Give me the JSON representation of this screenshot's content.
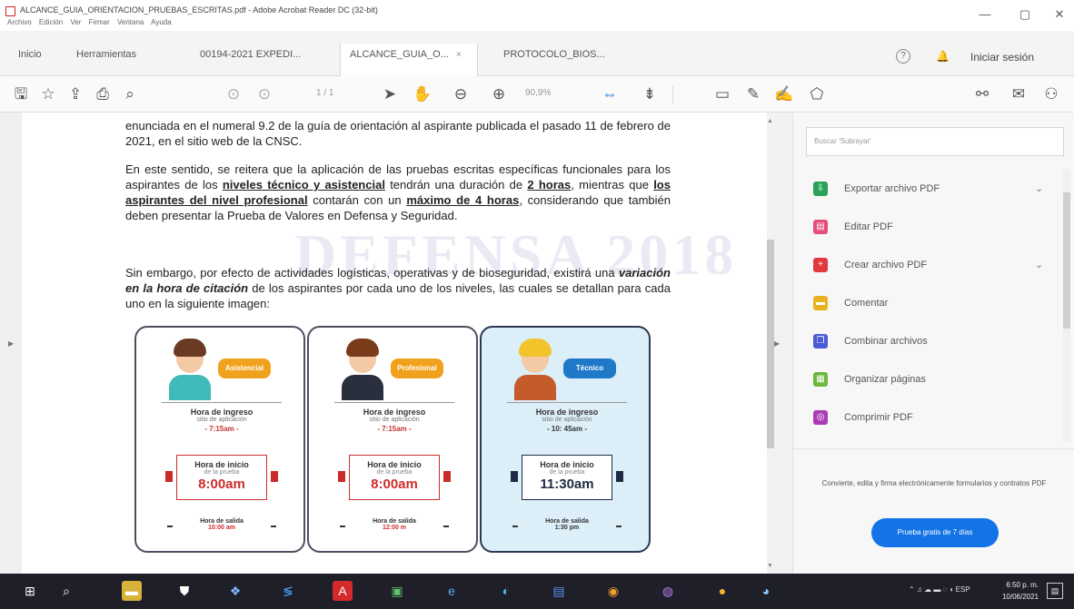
{
  "window": {
    "title": "ALCANCE_GUIA_ORIENTACION_PRUEBAS_ESCRITAS.pdf - Adobe Acrobat Reader DC (32-bit)",
    "menu": [
      "Archivo",
      "Edición",
      "Ver",
      "Firmar",
      "Ventana",
      "Ayuda"
    ],
    "controls": {
      "minimize": "—",
      "maximize": "▢",
      "close": "✕"
    }
  },
  "tabs": {
    "items": [
      {
        "label": "Inicio",
        "active": false
      },
      {
        "label": "Herramientas",
        "active": false
      },
      {
        "label": "00194-2021 EXPEDI...",
        "active": false
      },
      {
        "label": "ALCANCE_GUIA_O...",
        "active": true,
        "close": "×"
      },
      {
        "label": "PROTOCOLO_BIOS...",
        "active": false
      }
    ],
    "help": "?",
    "signin": "Iniciar sesión"
  },
  "toolbar": {
    "page": "1 / 1",
    "zoom": "90,9%"
  },
  "document": {
    "paragraph1": "enunciada en el numeral 9.2 de la guía de orientación al aspirante publicada el pasado 11 de febrero de 2021, en el sitio web de la CNSC.",
    "p2_a": "En este sentido, se reitera que la aplicación de las pruebas escritas específicas funcionales para los aspirantes de los ",
    "p2_b": "niveles técnico y asistencial",
    "p2_c": " tendrán una duración de ",
    "p2_d": "2 horas",
    "p2_e": ", mientras que ",
    "p2_f": "los aspirantes del nivel profesional",
    "p2_g": " contarán con un ",
    "p2_h": "máximo de 4 horas",
    "p2_i": ", considerando que también deben presentar la Prueba de Valores en Defensa y Seguridad.",
    "p3_a": "Sin embargo, por efecto de actividades logísticas, operativas y de bioseguridad, existirá una ",
    "p3_b": "variación en la hora de citación",
    "p3_c": " de los aspirantes por cada uno de los niveles, las cuales se detallan para cada uno en la siguiente imagen:",
    "watermark": "DEFENSA 2018",
    "cards": [
      {
        "badge": "Asistencial",
        "ingreso_label": "Hora de ingreso",
        "ingreso_sub": "sitio de aplicación",
        "ingreso_time": "- 7:15am -",
        "inicio_label": "Hora de inicio",
        "inicio_sub": "de la prueba",
        "inicio_time": "8:00am",
        "salida_label": "Hora de salida",
        "salida_time": "10:00 am"
      },
      {
        "badge": "Profesional",
        "ingreso_label": "Hora de ingreso",
        "ingreso_sub": "sitio de aplicación",
        "ingreso_time": "- 7:15am -",
        "inicio_label": "Hora de inicio",
        "inicio_sub": "de la prueba",
        "inicio_time": "8:00am",
        "salida_label": "Hora de salida",
        "salida_time": "12:00 m"
      },
      {
        "badge": "Técnico",
        "ingreso_label": "Hora de ingreso",
        "ingreso_sub": "sitio de aplicación",
        "ingreso_time": "- 10: 45am -",
        "inicio_label": "Hora de inicio",
        "inicio_sub": "de la prueba",
        "inicio_time": "11:30am",
        "salida_label": "Hora de salida",
        "salida_time": "1:30 pm"
      }
    ]
  },
  "panel": {
    "search_placeholder": "Buscar 'Subrayar'",
    "tools": [
      {
        "label": "Exportar archivo PDF",
        "icon": "export-pdf-icon",
        "color": "#29a35a",
        "chevron": "⌄"
      },
      {
        "label": "Editar PDF",
        "icon": "edit-pdf-icon",
        "color": "#e64d7a",
        "chevron": ""
      },
      {
        "label": "Crear archivo PDF",
        "icon": "create-pdf-icon",
        "color": "#e0393e",
        "chevron": "⌄"
      },
      {
        "label": "Comentar",
        "icon": "comment-icon",
        "color": "#e9b320",
        "chevron": ""
      },
      {
        "label": "Combinar archivos",
        "icon": "combine-files-icon",
        "color": "#4b5bd6",
        "chevron": ""
      },
      {
        "label": "Organizar páginas",
        "icon": "organize-pages-icon",
        "color": "#6bb83a",
        "chevron": ""
      },
      {
        "label": "Comprimir PDF",
        "icon": "compress-pdf-icon",
        "color": "#ab3bb5",
        "chevron": ""
      }
    ],
    "promo": "Convierte, edita y firma electrónicamente formularios y contratos PDF",
    "trial_button": "Prueba gratis de 7 días"
  },
  "taskbar": {
    "tray": "ESP",
    "time": "6:50 p. m.",
    "date": "10/06/2021"
  }
}
